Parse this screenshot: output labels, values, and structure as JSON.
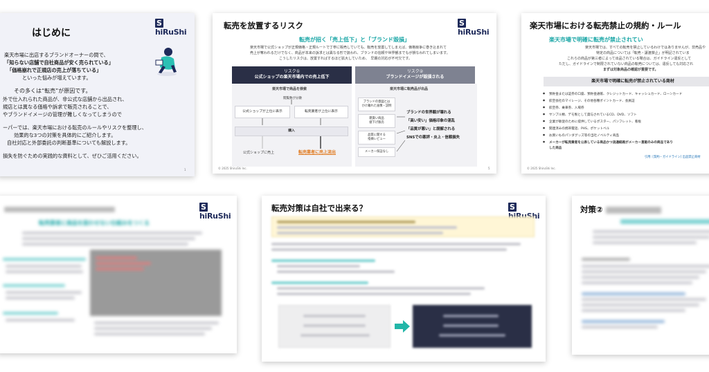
{
  "brand": {
    "logo_box": "S",
    "logo_text": "hiRuShi"
  },
  "colors": {
    "teal": "#1aa6a6",
    "navy": "#1e2a5a",
    "orange": "#e07a20"
  },
  "slide1": {
    "title": "はじめに",
    "lines": [
      "楽天市場に出店するブランドオーナーの間で、",
      "「知らない店舗で自社商品が安く売られている」",
      "「価格崩れで正規店の売上が落ちている」",
      "といった悩みが増えています。",
      "その多くは“転売”が原因です。",
      "外で仕入れられた商品が、非公式な店舗から出品され、",
      "規店とは異なる価格や訴求で販売されることで、",
      "やブランドイメージの管理が難しくなってしまうので",
      "ーパーでは、楽天市場における転売のルールやリスクを整理し、",
      "効果的な3つの対策を具体的にご紹介します。",
      "自社対応と外部委託の判断基準についても解説します。",
      "損失を防ぐための実践的な資料として、ぜひご活用ください。"
    ],
    "page": "1"
  },
  "slide2": {
    "title": "転売を放置するリスク",
    "subhead": "転売が招く「売上低下」と「ブランド毀損」",
    "intro": [
      "楽天市場で公式ショップが正規価格・正規ルートで丁寧に販売していても、転売を放置してしまえば、価格競争に巻き込まれて",
      "売上が奪われるだけでなく、商品が本来の訴求とは異なる形で扱われ、ブランドの信頼や世界観までもが損なわれてしまいます。",
      "こうしたリスクは、放置すればするほど拡大していため、　早期の対応が不可欠です。"
    ],
    "risk1_head": "リスク①",
    "risk1_title": "公式ショップの楽天市場内での売上低下",
    "risk2_head": "リスク②",
    "risk2_title": "ブランドイメージが毀損される",
    "r1_search": "楽天市場で商品を検索",
    "r1_filter": "閲覧数が分散",
    "r1_official": "公式ショップが上位に表示",
    "r1_reseller": "転売業者が上位に表示",
    "r1_buy": "購入",
    "r1_official_sales": "公式ショップに売上",
    "r1_reseller_sales": "転売業者に売上流出",
    "r2_listing": "楽天市場に転売品が出品",
    "r2_boxes": [
      "ブランドの意図とは\nかけ離れた画像・説明",
      "雑貨い商品\n値下げ販売",
      "品質に関する\n指摘レビュー",
      "メーカー保証なし"
    ],
    "r2_results": [
      "ブランドの世界観が壊れる",
      "「高い安い」価格印象の混乱",
      "「品質が悪い」と誤解される",
      "SNSでの悪評・炎上・信頼損失"
    ],
    "footer": "© 2025 ShiruShi Inc.",
    "page": "5"
  },
  "slide3": {
    "title": "楽天市場における転売禁止の規約・ルール",
    "subhead": "楽天市場で明確に転売が禁止されてい",
    "intro": [
      "楽天市場では、すべての転売を禁止しているわけではありませんが、非売品や",
      "特定の商品については「転売・譲渡禁止」が明記されていま",
      "これらの商品が第三者によって出品されている場合は、ガイドライン違反として",
      "ただし、ガイドラインで制限されていない商品の転売については、違反しても対応され",
      "まずは対象商品の確認が重要です。"
    ],
    "bar": "楽天市場で明確に転売が禁止されている商材",
    "items": [
      "預貯金または証券の口座、預貯金通帳、クレジットカード、キャッシュカード、ローンカード",
      "航空会社のマイレージ、その他各種ポイントカード、会員証",
      "航空券、乗車券、入場券",
      "サンプル類、デモ製として貸与されているCD、DVD、ソフト",
      "企業が販促のために提供しているポスター、パンフレット、看板",
      "関連済みの携帯電話、PHS、ポケットベル",
      "お買いものパンダグッズ等の当社ノベルティ商品",
      "メーカーが転売業者を公表している商品かつ流通経路がメーカー直販のみの商品であり",
      "した商品"
    ],
    "link": "引用: [契約・ガイドライン] 出品禁止商材",
    "footer": "© 2025 ShiruShi Inc."
  },
  "slide4": {
    "subhead": "転売業者に商品を扱わせない仕組みをつくる"
  },
  "slide5": {
    "title": "転売対策は自社で出来る？"
  },
  "slide6": {
    "title": "対策②"
  }
}
